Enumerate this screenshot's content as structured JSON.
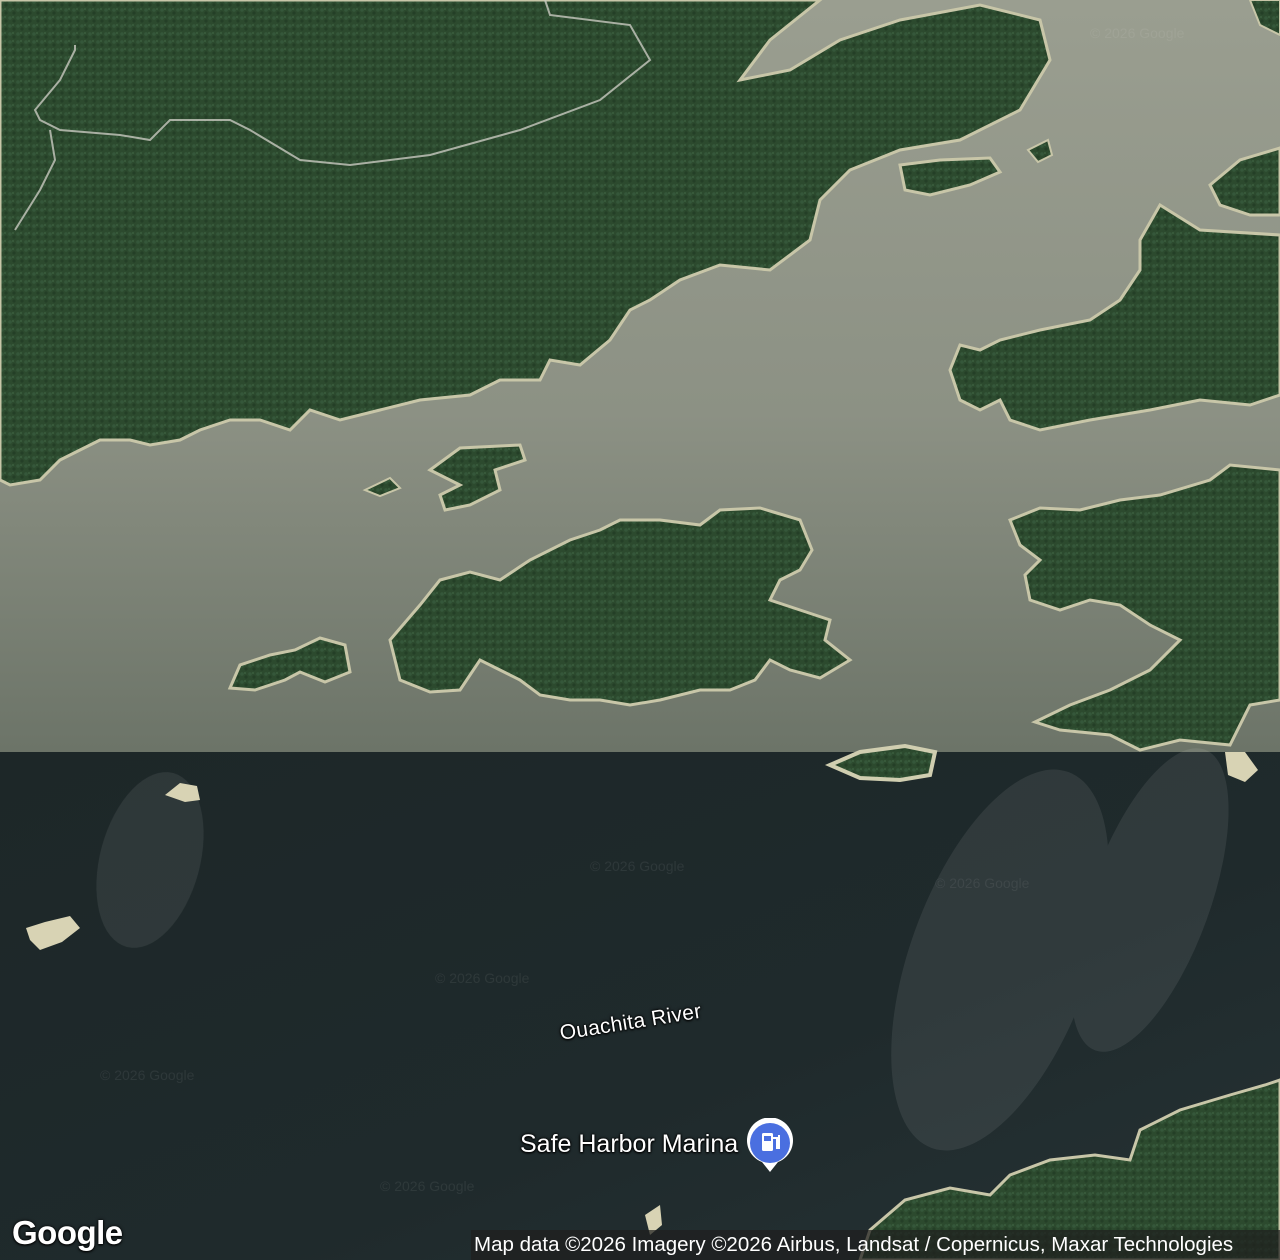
{
  "map": {
    "labels": {
      "river": "Ouachita River",
      "poi": "Safe Harbor Marina"
    },
    "poi_icon": "fuel-pump-icon",
    "logo": "Google",
    "attribution": "Map data ©2026 Imagery ©2026 Airbus, Landsat / Copernicus, Maxar Technologies",
    "watermark": "© 2026 Google",
    "colors": {
      "forest": "#2c4a2e",
      "forest_dark": "#1f3a22",
      "water_upper": "#8f9486",
      "water_lower": "#1c2628",
      "shore": "#c8c6a8",
      "pin": "#4a6fe0"
    }
  }
}
